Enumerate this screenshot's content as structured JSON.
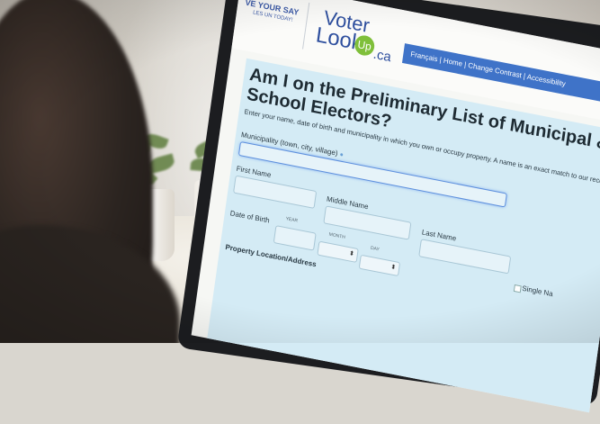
{
  "site": {
    "slogan_top": "VE YOUR SAY",
    "slogan_sub": "LES UN TODAY!",
    "logo_voter": "Voter",
    "logo_look": "Look",
    "logo_up": "Up",
    "logo_ca": ".ca",
    "nav": "Français | Home | Change Contrast | Accessibility"
  },
  "form": {
    "title": "Am I on the Preliminary List of Municipal & School Electors?",
    "instructions": "Enter your name, date of birth and municipality in which you own or occupy property. A name is an exact match to our records.",
    "municipality_label": "Municipality (town, city, village)",
    "first_name_label": "First Name",
    "middle_name_label": "Middle Name",
    "last_name_label": "Last Name",
    "dob_label": "Date of Birth",
    "year_label": "YEAR",
    "month_label": "MONTH",
    "day_label": "DAY",
    "single_name_label": "Single Na",
    "property_label": "Property Location/Address"
  },
  "colors": {
    "nav_bg": "#3f73c8",
    "form_bg": "#d4ebf5",
    "brand_blue": "#2e4f9e",
    "logo_green": "#7fbf3a"
  }
}
